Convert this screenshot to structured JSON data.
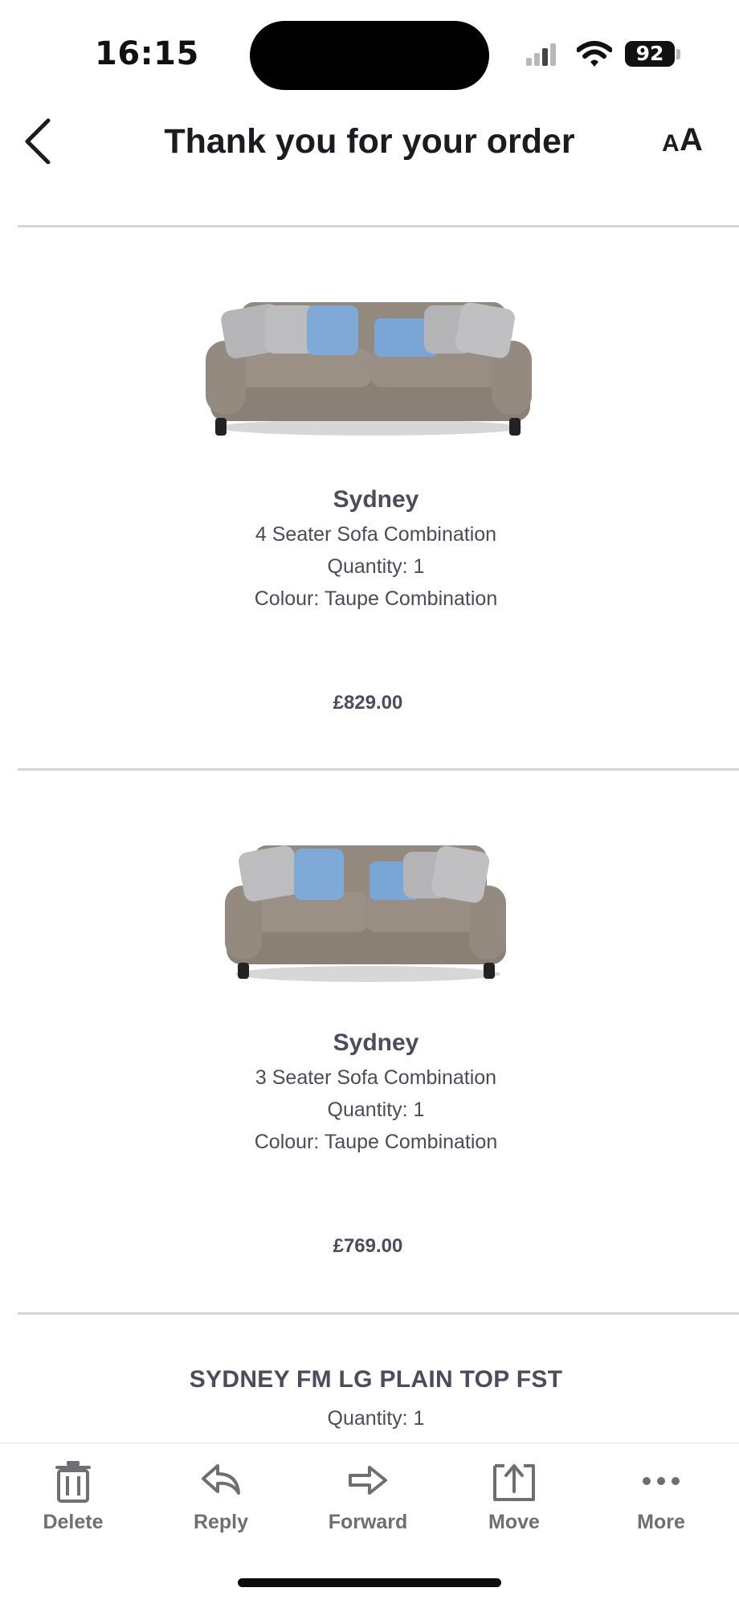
{
  "status_bar": {
    "time": "16:15",
    "battery": "92"
  },
  "header": {
    "title": "Thank you for your order",
    "back_icon": "chevron-left-icon",
    "text_size_icon": "text-size-icon"
  },
  "products": [
    {
      "name": "Sydney",
      "description": "4 Seater Sofa Combination",
      "quantity": "Quantity: 1",
      "colour": "Colour: Taupe Combination",
      "price": "£829.00"
    },
    {
      "name": "Sydney",
      "description": "3 Seater Sofa Combination",
      "quantity": "Quantity: 1",
      "colour": "Colour: Taupe Combination",
      "price": "£769.00"
    }
  ],
  "extra_item": {
    "title": "SYDNEY FM LG PLAIN TOP FST",
    "quantity": "Quantity: 1"
  },
  "toolbar": {
    "delete": "Delete",
    "reply": "Reply",
    "forward": "Forward",
    "move": "Move",
    "more": "More"
  },
  "colors": {
    "accent_cushion": "#7fa9d6",
    "sofa": "#8e847a",
    "label": "#6e6e73"
  }
}
